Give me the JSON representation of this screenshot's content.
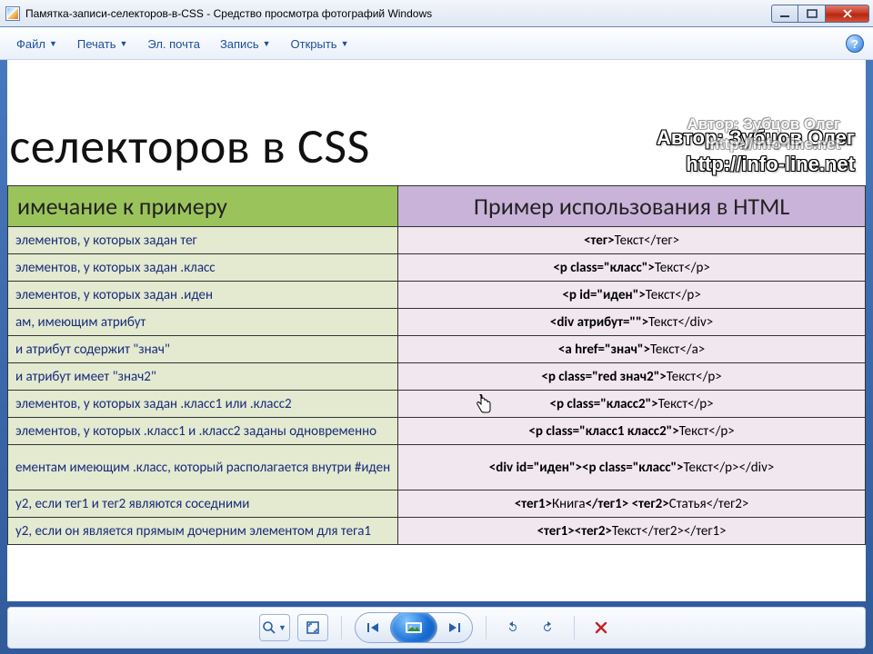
{
  "window": {
    "title": "Памятка-записи-селекторов-в-CSS - Средство просмотра фотографий Windows"
  },
  "menu": {
    "file": "Файл",
    "print": "Печать",
    "email": "Эл. почта",
    "burn": "Запись",
    "open": "Открыть"
  },
  "document": {
    "heading": "и селекторов в CSS",
    "note_header": "имечание к примеру",
    "html_header": "Пример использования в HTML",
    "credit_author": "Автор: Зубцов Олег",
    "credit_url": "http://info-line.net",
    "rows": [
      {
        "note": "элементов, у которых задан тег",
        "html": "<тег>Текст</тег>",
        "html_bold": "<тег>",
        "html_rest": "Текст</тег>"
      },
      {
        "note": "элементов, у которых задан .класс",
        "html_bold": "<p class=\"класс\">",
        "html_rest": "Текст</p>"
      },
      {
        "note": "элементов, у которых задан .иден",
        "html_bold": "<p id=\"иден\">",
        "html_rest": "Текст</p>"
      },
      {
        "note": "ам, имеющим атрибут",
        "html_bold": "<div атрибут=\"\">",
        "html_rest": "Текст</div>"
      },
      {
        "note": "и атрибут содержит \"знач\"",
        "html_bold": "<a href=\"знач\">",
        "html_rest": "Текст</a>"
      },
      {
        "note": "и атрибут имеет \"знач2\"",
        "html_bold": "<p class=\"red знач2\">",
        "html_rest": "Текст</p>"
      },
      {
        "note": "элементов, у которых задан .класс1 или .класс2",
        "html_bold": "<p class=\"класс2\">",
        "html_rest": "Текст</p>"
      },
      {
        "note": "элементов, у которых .класс1 и .класс2 заданы одновременно",
        "html_bold": "<p class=\"класс1 класс2\">",
        "html_rest": "Текст</p>"
      },
      {
        "note": "ементам имеющим .класс, который располагается внутри #иден",
        "html_bold": "<div id=\"иден\"><p class=\"класс\">",
        "html_rest": "Текст</p></div>"
      },
      {
        "note": "у2, если тег1 и тег2 являются соседними",
        "html_bold": "<тег1>",
        "html_mid": "Книга",
        "html_bold2": "</тег1> <тег2>",
        "html_rest": "Статья</тег2>"
      },
      {
        "note": "у2, если он является прямым дочерним элементом для тега1",
        "html_bold": "<тег1><тег2>",
        "html_rest": "Текст</тег2></тег1>"
      }
    ]
  }
}
